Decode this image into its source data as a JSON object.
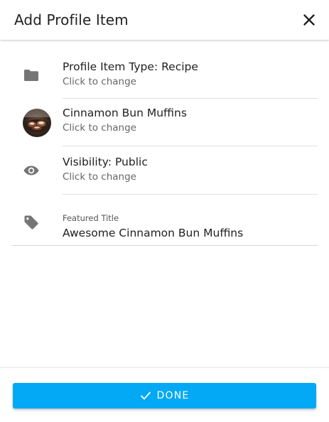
{
  "header": {
    "title": "Add Profile Item",
    "close_icon": "close-icon"
  },
  "items": [
    {
      "icon": "folder-icon",
      "title": "Profile Item Type: Recipe",
      "subtitle": "Click to change"
    },
    {
      "icon": "recipe-thumbnail",
      "title": "Cinnamon Bun Muffins",
      "subtitle": "Click to change"
    },
    {
      "icon": "eye-icon",
      "title": "Visibility: Public",
      "subtitle": "Click to change"
    }
  ],
  "featured_title": {
    "icon": "tag-icon",
    "label": "Featured Title",
    "value": "Awesome Cinnamon Bun Muffins"
  },
  "footer": {
    "done_label": "DONE",
    "done_icon": "check-icon"
  },
  "colors": {
    "accent": "#03a9f4",
    "icon_gray": "#757575"
  }
}
